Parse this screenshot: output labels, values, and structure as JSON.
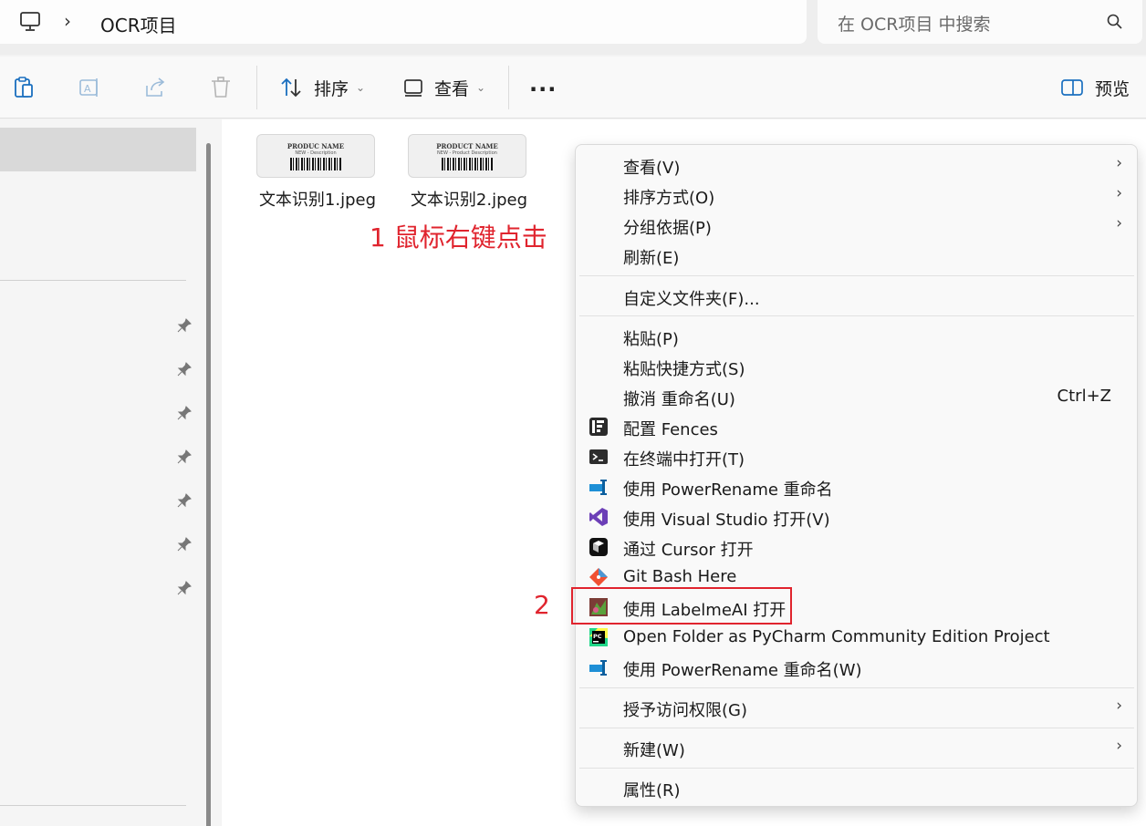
{
  "address": {
    "chevron": "›",
    "path": "OCR项目",
    "search_placeholder": "在 OCR项目 中搜索"
  },
  "toolbar": {
    "sort_label": "排序",
    "view_label": "查看",
    "more_label": "···",
    "preview_label": "预览"
  },
  "files": [
    {
      "name": "文本识别1.jpeg",
      "thumb_title": "PRODUC    NAME",
      "thumb_desc": "NEW -          Description"
    },
    {
      "name": "文本识别2.jpeg",
      "thumb_title": "PRODUCT NAME",
      "thumb_desc": "NEW - Product Description"
    }
  ],
  "annotations": {
    "step1": "1 鼠标右键点击",
    "step2": "2"
  },
  "menu": {
    "items": [
      {
        "label": "查看(V)",
        "submenu": true
      },
      {
        "label": "排序方式(O)",
        "submenu": true
      },
      {
        "label": "分组依据(P)",
        "submenu": true
      },
      {
        "label": "刷新(E)"
      },
      {
        "label": "自定义文件夹(F)..."
      },
      {
        "label": "粘贴(P)"
      },
      {
        "label": "粘贴快捷方式(S)"
      },
      {
        "label": "撤消 重命名(U)",
        "shortcut": "Ctrl+Z"
      },
      {
        "label": "配置 Fences",
        "icon": "fences-icon"
      },
      {
        "label": "在终端中打开(T)",
        "icon": "terminal-icon"
      },
      {
        "label": "使用 PowerRename 重命名",
        "icon": "powerrename-icon"
      },
      {
        "label": "使用 Visual Studio 打开(V)",
        "icon": "visual-studio-icon"
      },
      {
        "label": "通过 Cursor 打开",
        "icon": "cursor-icon"
      },
      {
        "label": "Git Bash Here",
        "icon": "git-icon"
      },
      {
        "label": "使用 LabelmeAI 打开",
        "icon": "labelme-icon"
      },
      {
        "label": "Open Folder as PyCharm Community Edition Project",
        "icon": "pycharm-icon"
      },
      {
        "label": "使用 PowerRename 重命名(W)",
        "icon": "powerrename-icon"
      },
      {
        "label": "授予访问权限(G)",
        "submenu": true
      },
      {
        "label": "新建(W)",
        "submenu": true
      },
      {
        "label": "属性(R)"
      }
    ],
    "submenu_arrow": "›"
  },
  "colors": {
    "annotation": "#e0242e",
    "selection": "#d9d9d9"
  }
}
